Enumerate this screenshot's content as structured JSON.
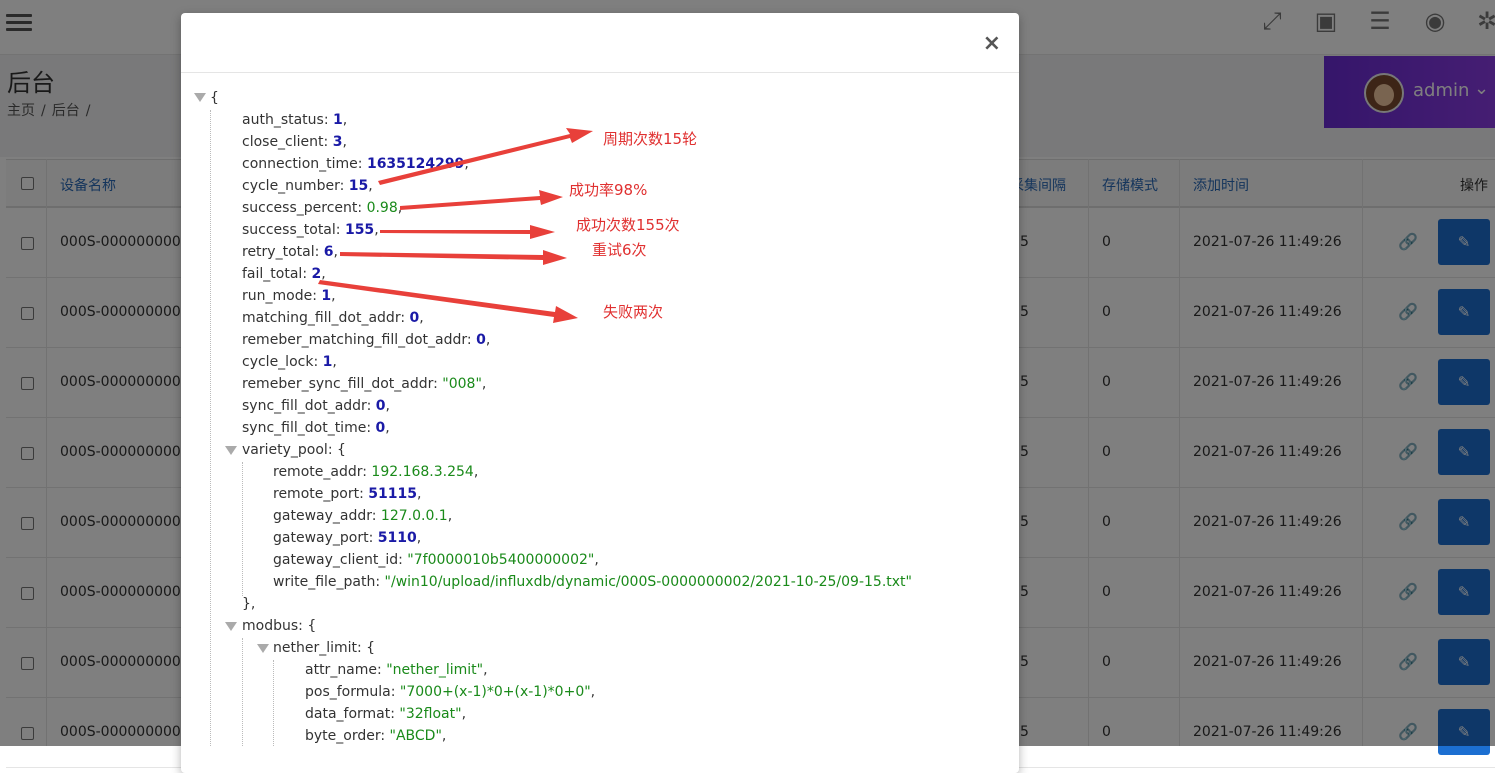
{
  "header": {
    "page_title": "后台",
    "breadcrumb": [
      "主页",
      "/",
      "后台",
      "/"
    ],
    "user_name": "admin",
    "top_icons": [
      "fullscreen-icon",
      "image-icon",
      "database-icon",
      "eye-icon",
      "gear-icon"
    ]
  },
  "table": {
    "headers": {
      "device_name": "设备名称",
      "collect_interval": "采集间隔",
      "storage_mode": "存储模式",
      "add_time": "添加时间",
      "actions": "操作"
    },
    "rows": [
      {
        "name": "000S-000000000",
        "interval": "5",
        "mode": "0",
        "time": "2021-07-26 11:49:26"
      },
      {
        "name": "000S-000000000",
        "interval": "5",
        "mode": "0",
        "time": "2021-07-26 11:49:26"
      },
      {
        "name": "000S-000000000",
        "interval": "5",
        "mode": "0",
        "time": "2021-07-26 11:49:26"
      },
      {
        "name": "000S-000000000",
        "interval": "5",
        "mode": "0",
        "time": "2021-07-26 11:49:26"
      },
      {
        "name": "000S-000000000",
        "interval": "5",
        "mode": "0",
        "time": "2021-07-26 11:49:26"
      },
      {
        "name": "000S-000000000",
        "interval": "5",
        "mode": "0",
        "time": "2021-07-26 11:49:26"
      },
      {
        "name": "000S-000000000",
        "interval": "5",
        "mode": "0",
        "time": "2021-07-26 11:49:26"
      },
      {
        "name": "000S-000000000",
        "interval": "5",
        "mode": "0",
        "time": "2021-07-26 11:49:26"
      }
    ]
  },
  "modal": {
    "close_label": "×",
    "json_lines": [
      {
        "key": "auth_status",
        "val": "1",
        "type": "num"
      },
      {
        "key": "close_client",
        "val": "3",
        "type": "num"
      },
      {
        "key": "connection_time",
        "val": "1635124299",
        "type": "num"
      },
      {
        "key": "cycle_number",
        "val": "15",
        "type": "num"
      },
      {
        "key": "success_percent",
        "val": "0.98",
        "type": "float"
      },
      {
        "key": "success_total",
        "val": "155",
        "type": "num"
      },
      {
        "key": "retry_total",
        "val": "6",
        "type": "num"
      },
      {
        "key": "fail_total",
        "val": "2",
        "type": "num"
      },
      {
        "key": "run_mode",
        "val": "1",
        "type": "num"
      },
      {
        "key": "matching_fill_dot_addr",
        "val": "0",
        "type": "num"
      },
      {
        "key": "remeber_matching_fill_dot_addr",
        "val": "0",
        "type": "num"
      },
      {
        "key": "cycle_lock",
        "val": "1",
        "type": "num"
      },
      {
        "key": "remeber_sync_fill_dot_addr",
        "val": "\"008\"",
        "type": "str"
      },
      {
        "key": "sync_fill_dot_addr",
        "val": "0",
        "type": "num"
      },
      {
        "key": "sync_fill_dot_time",
        "val": "0",
        "type": "num"
      }
    ],
    "variety_pool_key": "variety_pool",
    "variety_pool": [
      {
        "key": "remote_addr",
        "val": "192.168.3.254",
        "type": "str"
      },
      {
        "key": "remote_port",
        "val": "51115",
        "type": "num"
      },
      {
        "key": "gateway_addr",
        "val": "127.0.0.1",
        "type": "str"
      },
      {
        "key": "gateway_port",
        "val": "5110",
        "type": "num"
      },
      {
        "key": "gateway_client_id",
        "val": "\"7f0000010b5400000002\"",
        "type": "str"
      },
      {
        "key": "write_file_path",
        "val": "\"/win10/upload/influxdb/dynamic/000S-0000000002/2021-10-25/09-15.txt\"",
        "type": "str"
      }
    ],
    "modbus_key": "modbus",
    "nether_limit_key": "nether_limit",
    "nether_limit": [
      {
        "key": "attr_name",
        "val": "\"nether_limit\"",
        "type": "str"
      },
      {
        "key": "pos_formula",
        "val": "\"7000+(x-1)*0+(x-1)*0+0\"",
        "type": "str"
      },
      {
        "key": "data_format",
        "val": "\"32float\"",
        "type": "str"
      },
      {
        "key": "byte_order",
        "val": "\"ABCD\"",
        "type": "str"
      }
    ]
  },
  "annotations": {
    "cycle": "周期次数15轮",
    "success_rate": "成功率98%",
    "success_count": "成功次数155次",
    "retry": "重试6次",
    "fail": "失败两次"
  },
  "colors": {
    "accent_blue": "#1c6fd1",
    "admin_purple": "#7b34de",
    "annotation_red": "#e03030",
    "json_number": "#1a1aa6",
    "json_string": "#1a8a1a"
  }
}
